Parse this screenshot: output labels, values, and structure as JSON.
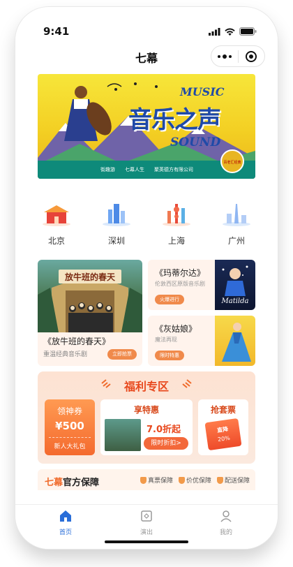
{
  "status": {
    "time": "9:41"
  },
  "nav": {
    "title": "七幕"
  },
  "banner": {
    "headline": "音乐之声",
    "music": "MUSIC",
    "sound": "SOUND",
    "sponsors": [
      "街趣游",
      "七幕人生",
      "聚英德方有限公司"
    ],
    "badge": "百老汇经典"
  },
  "cities": [
    {
      "name": "北京",
      "icon": "beijing-gate-icon"
    },
    {
      "name": "深圳",
      "icon": "shenzhen-skyline-icon"
    },
    {
      "name": "上海",
      "icon": "shanghai-tower-icon"
    },
    {
      "name": "广州",
      "icon": "guangzhou-tower-icon"
    }
  ],
  "shows": {
    "featured": {
      "name": "《放牛班的春天》",
      "sub": "重温经典音乐剧",
      "button": "立即抢票",
      "poster_title": "放牛班的春天"
    },
    "side": [
      {
        "name": "《玛蒂尔达》",
        "sub": "伦敦西区原版音乐剧",
        "button": "火爆进行",
        "thumb_text": "Matilda"
      },
      {
        "name": "《灰姑娘》",
        "sub": "魔法再现",
        "button": "限时特惠"
      }
    ]
  },
  "welfare": {
    "title": "福利专区",
    "coupon": {
      "title": "领神券",
      "value": "¥500",
      "sub": "新人大礼包"
    },
    "deal": {
      "title": "享特惠",
      "value": "7.0折起",
      "button": "限时折扣>"
    },
    "package": {
      "title": "抢套票",
      "ticket_line1": "直降",
      "ticket_line2": "20%"
    }
  },
  "guarantee": {
    "brand": "七幕",
    "title": "官方保障",
    "items": [
      "真票保障",
      "价优保障",
      "配送保障"
    ]
  },
  "tabs": [
    {
      "label": "首页",
      "icon": "home-icon",
      "active": true
    },
    {
      "label": "演出",
      "icon": "ticket-icon",
      "active": false
    },
    {
      "label": "我的",
      "icon": "user-icon",
      "active": false
    }
  ],
  "colors": {
    "accent": "#f06a2a",
    "tab_active": "#2a6ed8"
  }
}
